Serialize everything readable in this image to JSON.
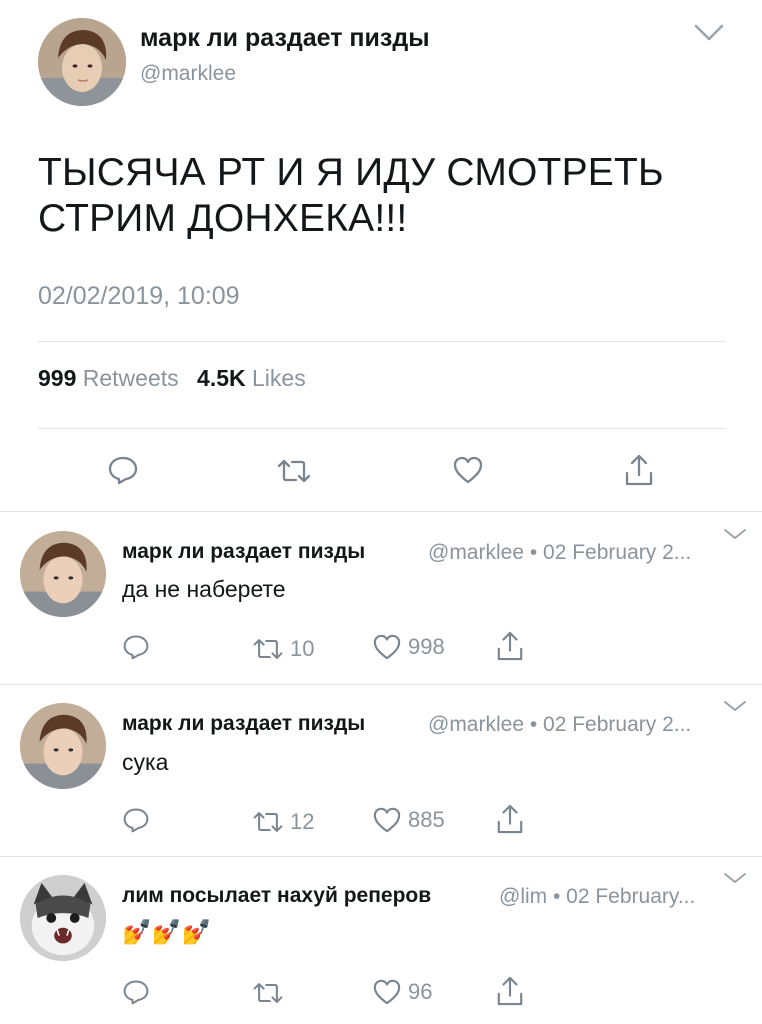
{
  "main_tweet": {
    "display_name": "марк ли раздает пизды",
    "handle": "@marklee",
    "text_line1": "ТЫСЯЧА РТ И Я ИДУ СМОТРЕТЬ",
    "text_line2": "СТРИМ ДОНХЕКА!!!",
    "timestamp": "02/02/2019, 10:09",
    "retweets_count": "999",
    "retweets_label": "Retweets",
    "likes_count": "4.5K",
    "likes_label": "Likes"
  },
  "replies": [
    {
      "display_name": "марк ли раздает пизды",
      "meta": "@marklee • 02 February 2...",
      "text": "да не наберете",
      "retweets": "10",
      "likes": "998"
    },
    {
      "display_name": "марк ли раздает пизды",
      "meta": "@marklee • 02 February 2...",
      "text": "сука",
      "retweets": "12",
      "likes": "885"
    },
    {
      "display_name": "лим посылает нахуй реперов",
      "meta": "@lim • 02 February...",
      "text": "💅💅💅",
      "retweets": "",
      "likes": "96"
    }
  ],
  "colors": {
    "text": "#14171a",
    "secondary": "#8a949c",
    "divider": "#dfe3e6"
  }
}
